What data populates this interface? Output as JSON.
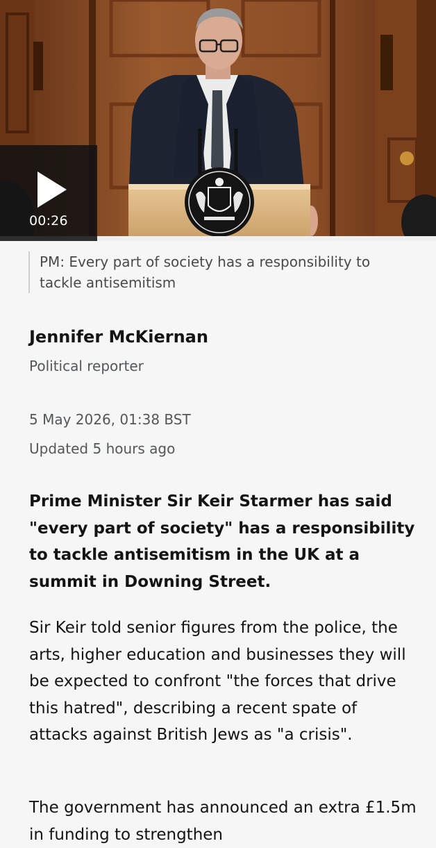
{
  "video": {
    "duration": "00:26",
    "play_icon": "play-icon",
    "caption": "PM: Every part of society has a responsibility to tackle antisemitism"
  },
  "byline": {
    "author": "Jennifer McKiernan",
    "role": "Political reporter",
    "date": "5 May 2026, 01:38 BST",
    "updated": "Updated 5 hours ago"
  },
  "article": {
    "lead": "Prime Minister Sir Keir Starmer has said \"every part of society\" has a responsibility to tackle antisemitism in the UK at a summit in Downing Street.",
    "paragraphs": [
      "Sir Keir told senior figures from the police, the arts, higher education and businesses they will be expected to confront \"the forces that drive this hatred\", describing a recent spate of attacks against British Jews as \"a crisis\".",
      "The government has announced an extra £1.5m in funding to strengthen"
    ]
  },
  "colors": {
    "page_background": "#f6f6f6",
    "text_primary": "#141414",
    "text_secondary": "#545658",
    "play_overlay": "#121212"
  }
}
